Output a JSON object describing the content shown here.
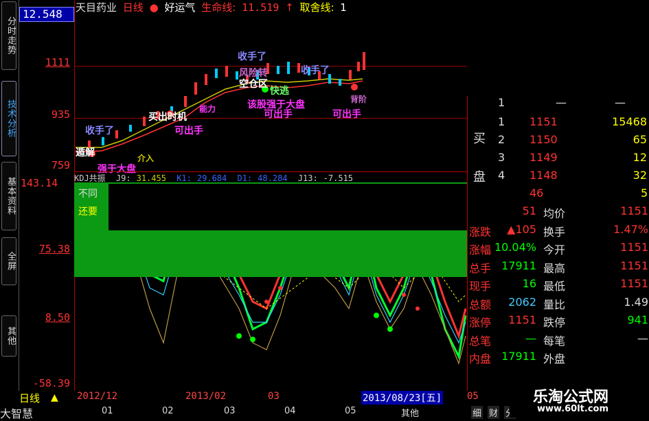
{
  "left_tabs": [
    "分时走势",
    "技术分析",
    "基本资料",
    "全屏",
    "其他"
  ],
  "price_box": "12.548",
  "axis_top": [
    "1111",
    "935",
    "759"
  ],
  "axis_bottom": [
    "143.14",
    "75.38",
    "8.50",
    "-58.39"
  ],
  "header": {
    "stock": "天目药业",
    "period": "日线",
    "indicator": "好运气",
    "lifeline_label": "生命线:",
    "lifeline_value": "11.519",
    "takeoff_label": "取舍线:",
    "takeoff_value": "1"
  },
  "annotations": {
    "shou_shou_1": "收手了",
    "shou_shou_2": "收手了",
    "feng_xian": "风险转",
    "kong_xian": "空仓区",
    "kuai_tao": "快逃",
    "gai_gu": "该股强于大盘",
    "ke_chu_1": "可出手",
    "ke_chu_2": "可出手",
    "ke_chu_3": "可出手",
    "ma_chu": "买出时机",
    "neng_li": "能力",
    "shou_shou_left": "收手了",
    "dun_jie": "遁解",
    "jie_ru": "介入",
    "qiang_yu": "强于大盘",
    "bei_fen": "背阶"
  },
  "kdj": {
    "name": "KDJ共振",
    "j9_label": "J9:",
    "j9_value": "31.455",
    "k_label": "K1:",
    "k_value": "29.684",
    "d_label": "D1:",
    "d_value": "48.284",
    "j13_label": "J13:",
    "j13_value": "-7.515"
  },
  "kdj_band": {
    "not_label": "不同",
    "return_label": "还要"
  },
  "order_book": {
    "sell1_level": "1",
    "sell1_price": "—",
    "sell1_vol": "—",
    "buy_label_top": "买",
    "buy_label_bottom": "盘",
    "rows": [
      {
        "level": "1",
        "price": "1151",
        "vol": "15468"
      },
      {
        "level": "2",
        "price": "1150",
        "vol": "65"
      },
      {
        "level": "3",
        "price": "1149",
        "vol": "12"
      },
      {
        "level": "4",
        "price": "1148",
        "vol": "32"
      }
    ],
    "extra_price": "46",
    "extra_vol": "5"
  },
  "quote": [
    {
      "l1": "",
      "v1": "51",
      "l2": "均价",
      "v2": "1151"
    },
    {
      "l1": "涨跌",
      "v1": "▲105",
      "l2": "换手",
      "v2": "1.47%"
    },
    {
      "l1": "涨幅",
      "v1": "10.04%",
      "l2": "今开",
      "v2": "1151"
    },
    {
      "l1": "总手",
      "v1": "17911",
      "l2": "最高",
      "v2": "1151"
    },
    {
      "l1": "现手",
      "v1": "16",
      "l2": "最低",
      "v2": "1151"
    },
    {
      "l1": "总额",
      "v1": "2062",
      "l2": "量比",
      "v2": "1.49"
    },
    {
      "l1": "涨停",
      "v1": "1151",
      "l2": "跌停",
      "v2": "941"
    },
    {
      "l1": "总笔",
      "v1": "—",
      "l2": "每笔",
      "v2": "—"
    },
    {
      "l1": "内盘",
      "v1": "17911",
      "l2": "外盘",
      "v2": ""
    }
  ],
  "bottom": {
    "period": "日线",
    "app": "大智慧",
    "dates": [
      "2012/12",
      "2013/02",
      "03",
      "2013/08/23[五]",
      "05"
    ],
    "months": [
      "01",
      "02",
      "03",
      "04",
      "05",
      "其他"
    ],
    "tabs": [
      "细",
      "财",
      "分"
    ]
  },
  "watermark": {
    "title": "乐淘公式网",
    "url": "www.60lt.com"
  }
}
